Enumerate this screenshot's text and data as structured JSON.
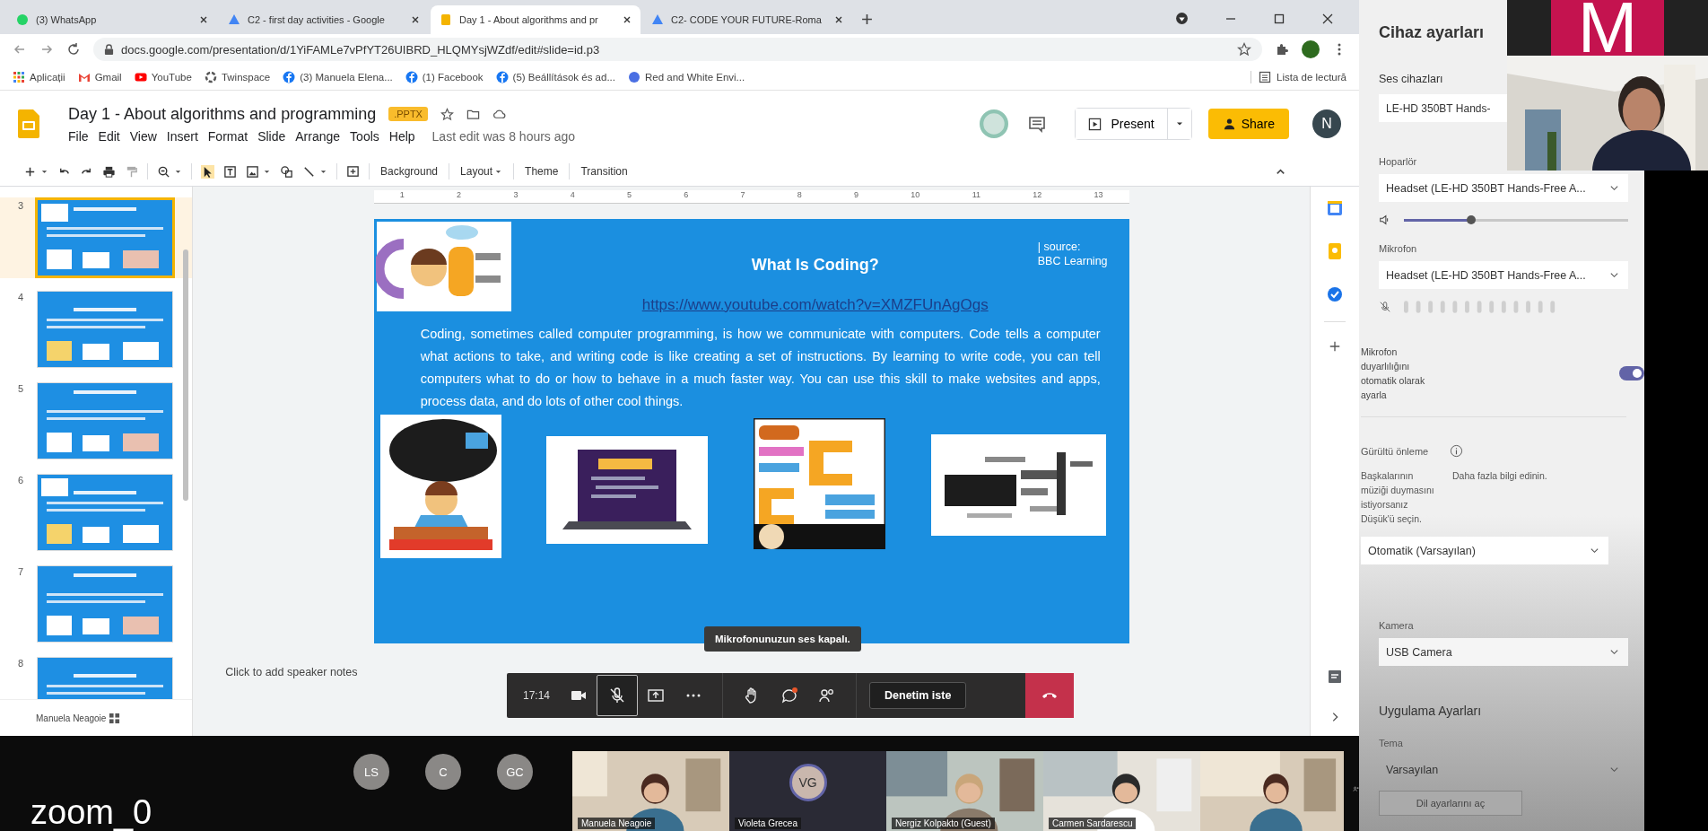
{
  "browser": {
    "tabs": [
      {
        "kind": "whatsapp",
        "title": "(3) WhatsApp",
        "selected": false
      },
      {
        "kind": "drive",
        "title": "C2 - first day activities - Google",
        "selected": false
      },
      {
        "kind": "slides",
        "title": "Day 1 - About algorithms and pr",
        "selected": true
      },
      {
        "kind": "drive",
        "title": "C2- CODE YOUR FUTURE-Roma",
        "selected": false
      }
    ],
    "url": "docs.google.com/presentation/d/1YiFAMLe7vPfYT26UIBRD_HLQMYsjWZdf/edit#slide=id.p3",
    "bookmarks": [
      {
        "kind": "apps",
        "label": "Aplicații"
      },
      {
        "kind": "gmail",
        "label": "Gmail"
      },
      {
        "kind": "youtube",
        "label": "YouTube"
      },
      {
        "kind": "twinspace",
        "label": "Twinspace"
      },
      {
        "kind": "facebook",
        "label": "(3) Manuela Elena..."
      },
      {
        "kind": "facebook",
        "label": "(1) Facebook"
      },
      {
        "kind": "facebook",
        "label": "(5) Beállítások és ad..."
      },
      {
        "kind": "globe",
        "label": "Red and White Envi..."
      }
    ],
    "reading_list": "Lista de lectură"
  },
  "docs": {
    "title": "Day 1 - About algorithms and programming",
    "badge": ".PPTX",
    "menu": [
      "File",
      "Edit",
      "View",
      "Insert",
      "Format",
      "Slide",
      "Arrange",
      "Tools",
      "Help"
    ],
    "last_edit": "Last edit was 8 hours ago",
    "present": "Present",
    "share": "Share",
    "user_initial": "N",
    "toolbar": [
      "Background",
      "Layout",
      "Theme",
      "Transition"
    ],
    "ruler": [
      "1",
      "2",
      "3",
      "4",
      "5",
      "6",
      "7",
      "8",
      "9",
      "10",
      "11",
      "12",
      "13"
    ],
    "thumbnails": [
      {
        "number": "3",
        "selected": true
      },
      {
        "number": "4",
        "selected": false
      },
      {
        "number": "5",
        "selected": false
      },
      {
        "number": "6",
        "selected": false
      },
      {
        "number": "7",
        "selected": false
      },
      {
        "number": "8",
        "selected": false
      }
    ],
    "speaker_notes": "Click to add speaker notes"
  },
  "slide": {
    "title": "What Is Coding?",
    "link": "https://www.youtube.com/watch?v=XMZFUnAgOgs",
    "source": [
      "| source:",
      "BBC Learning"
    ],
    "body": "Coding, sometimes called computer programming, is how we communicate with computers. Code tells a computer what actions to take, and writing code is like creating a set of instructions. By learning to write code, you can tell computers what to do or how to behave in a much faster way. You can use this skill to make websites and apps, process data, and do lots of other cool things."
  },
  "meeting": {
    "toast": "Mikrofonunuzun ses kapalı.",
    "time": "17:14",
    "mic_muted": true,
    "chat_unread": true,
    "request_control": "Denetim iste",
    "presenter": "Manuela Neagoie"
  },
  "participants": {
    "avatars": [
      "LS",
      "C",
      "GC"
    ],
    "tiles": [
      {
        "kind": "picture",
        "name": "Manuela Neagoie"
      },
      {
        "kind": "avatar",
        "initials": "VG",
        "name": "Violeta Grecea"
      },
      {
        "kind": "picture",
        "name": "Nergiz Kolpakto (Guest)"
      },
      {
        "kind": "picture",
        "name": "Carmen Sardarescu"
      },
      {
        "kind": "picture"
      }
    ],
    "label": "zoom_0"
  },
  "self_view": {
    "initial": "M"
  },
  "settings": {
    "title": "Cihaz ayarları",
    "audio_label": "Ses cihazları",
    "audio_device": "LE-HD 350BT Hands-",
    "speaker_label": "Hoparlör",
    "speaker": "Headset (LE-HD 350BT Hands-Free A...",
    "speaker_volume": {
      "level": 0.3
    },
    "mic_label": "Mikrofon",
    "mic": "Headset (LE-HD 350BT Hands-Free A...",
    "auto_sensitivity": {
      "label": "Mikrofon duyarlılığını otomatik olarak ayarla",
      "on": true
    },
    "noise_label": "Gürültü önleme",
    "noise_help": "Başkalarının müziği duymasını istiyorsanız Düşük'ü seçin.",
    "learn_more": "Daha fazla bilgi edinin.",
    "noise": "Otomatik (Varsayılan)",
    "camera_label": "Kamera",
    "camera": "USB Camera",
    "app_label": "Uygulama Ayarları",
    "theme_label": "Tema",
    "theme": "Varsayılan",
    "language_button": "Dil ayarlarını aç"
  }
}
